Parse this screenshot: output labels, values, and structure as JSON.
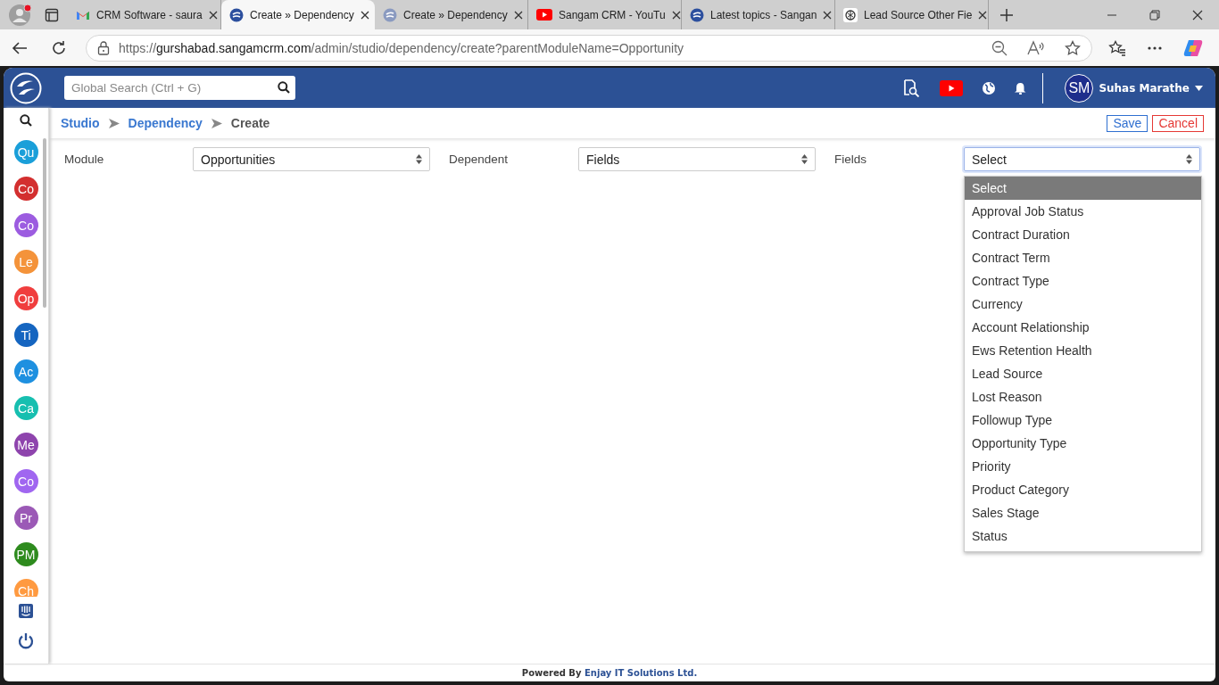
{
  "browser": {
    "tabs": [
      {
        "title": "CRM Software - saura",
        "selected": false
      },
      {
        "title": "Create » Dependency",
        "selected": true
      },
      {
        "title": "Create » Dependency",
        "selected": false
      },
      {
        "title": "Sangam CRM - YouTu",
        "selected": false
      },
      {
        "title": "Latest topics - Sangan",
        "selected": false
      },
      {
        "title": "Lead Source Other Fie",
        "selected": false
      }
    ],
    "url": {
      "scheme": "https://",
      "host": "gurshabad.sangamcrm.com",
      "path": "/admin/studio/dependency/create?parentModuleName=Opportunity"
    }
  },
  "header": {
    "search": {
      "placeholder": "Global Search (Ctrl + G)"
    },
    "user": {
      "initials": "SM",
      "name": "Suhas Marathe"
    }
  },
  "sidebar": {
    "modules": [
      {
        "initials": "Qu",
        "color": "#1a9fd9"
      },
      {
        "initials": "Co",
        "color": "#d32f2f"
      },
      {
        "initials": "Co",
        "color": "#9c5ce0"
      },
      {
        "initials": "Le",
        "color": "#f4933a"
      },
      {
        "initials": "Op",
        "color": "#f03e3e"
      },
      {
        "initials": "Ti",
        "color": "#1565c0"
      },
      {
        "initials": "Ac",
        "color": "#1e90e0"
      },
      {
        "initials": "Ca",
        "color": "#17bfb0"
      },
      {
        "initials": "Me",
        "color": "#8e44ad"
      },
      {
        "initials": "Co",
        "color": "#a066f0"
      },
      {
        "initials": "Pr",
        "color": "#9b59b6"
      },
      {
        "initials": "PM",
        "color": "#2e8b1e"
      },
      {
        "initials": "Ch",
        "color": "#ff9a40"
      }
    ]
  },
  "breadcrumbs": [
    {
      "label": "Studio",
      "kind": "link"
    },
    {
      "label": "Dependency",
      "kind": "link"
    },
    {
      "label": "Create",
      "kind": "current"
    }
  ],
  "actions": [
    {
      "label": "Save",
      "kind": "primary"
    },
    {
      "label": "Cancel",
      "kind": "danger"
    }
  ],
  "form": [
    {
      "label": "Module",
      "value": "Opportunities",
      "expanded": false
    },
    {
      "label": "Dependent",
      "value": "Fields",
      "expanded": false
    },
    {
      "label": "Fields",
      "value": "Select",
      "expanded": true,
      "options": [
        {
          "label": "Select",
          "selected": true
        },
        {
          "label": "Approval Job Status",
          "selected": false
        },
        {
          "label": "Contract Duration",
          "selected": false
        },
        {
          "label": "Contract Term",
          "selected": false
        },
        {
          "label": "Contract Type",
          "selected": false
        },
        {
          "label": "Currency",
          "selected": false
        },
        {
          "label": "Account Relationship",
          "selected": false
        },
        {
          "label": "Ews Retention Health",
          "selected": false
        },
        {
          "label": "Lead Source",
          "selected": false
        },
        {
          "label": "Lost Reason",
          "selected": false
        },
        {
          "label": "Followup Type",
          "selected": false
        },
        {
          "label": "Opportunity Type",
          "selected": false
        },
        {
          "label": "Priority",
          "selected": false
        },
        {
          "label": "Product Category",
          "selected": false
        },
        {
          "label": "Sales Stage",
          "selected": false
        },
        {
          "label": "Status",
          "selected": false
        }
      ]
    }
  ],
  "footer": {
    "text": "Powered By ",
    "link": "Enjay IT Solutions Ltd."
  }
}
